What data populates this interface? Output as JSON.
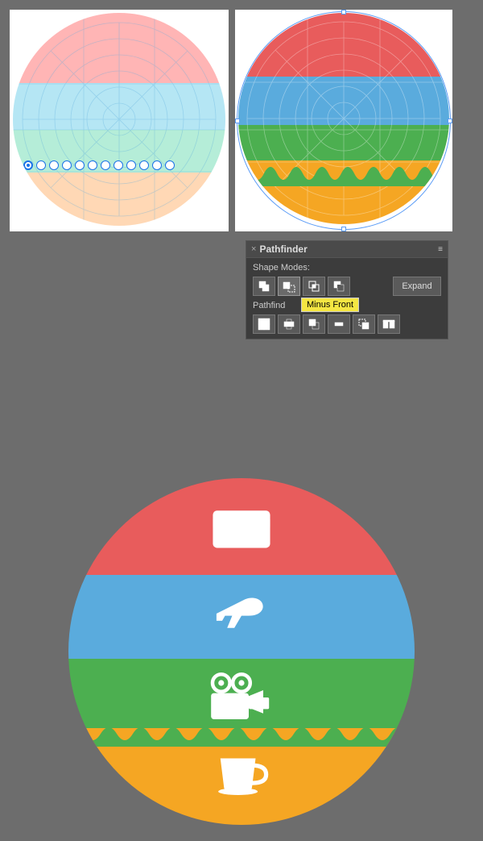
{
  "top_section": {
    "left_diagram": {
      "alt": "Left circle diagram with color segments and grid"
    },
    "right_diagram": {
      "alt": "Right circle diagram with solid color segments"
    }
  },
  "pathfinder": {
    "title": "Pathfinder",
    "shape_modes_label": "Shape Modes:",
    "pathfind_label": "Pathfind",
    "expand_label": "Expand",
    "close_label": "×",
    "tooltip_text": "Minus Front",
    "buttons": {
      "shape_modes": [
        "unite",
        "minus-front",
        "intersect",
        "exclude"
      ],
      "pathfind": [
        "trim",
        "merge",
        "crop",
        "outline",
        "minus-back",
        "divide"
      ]
    }
  },
  "bottom_circle": {
    "alt": "Large circle with four colored segments and icons",
    "segments": [
      "red",
      "blue",
      "green",
      "orange"
    ],
    "icons": [
      "credit-card",
      "airplane",
      "video-camera",
      "coffee-cup"
    ]
  }
}
